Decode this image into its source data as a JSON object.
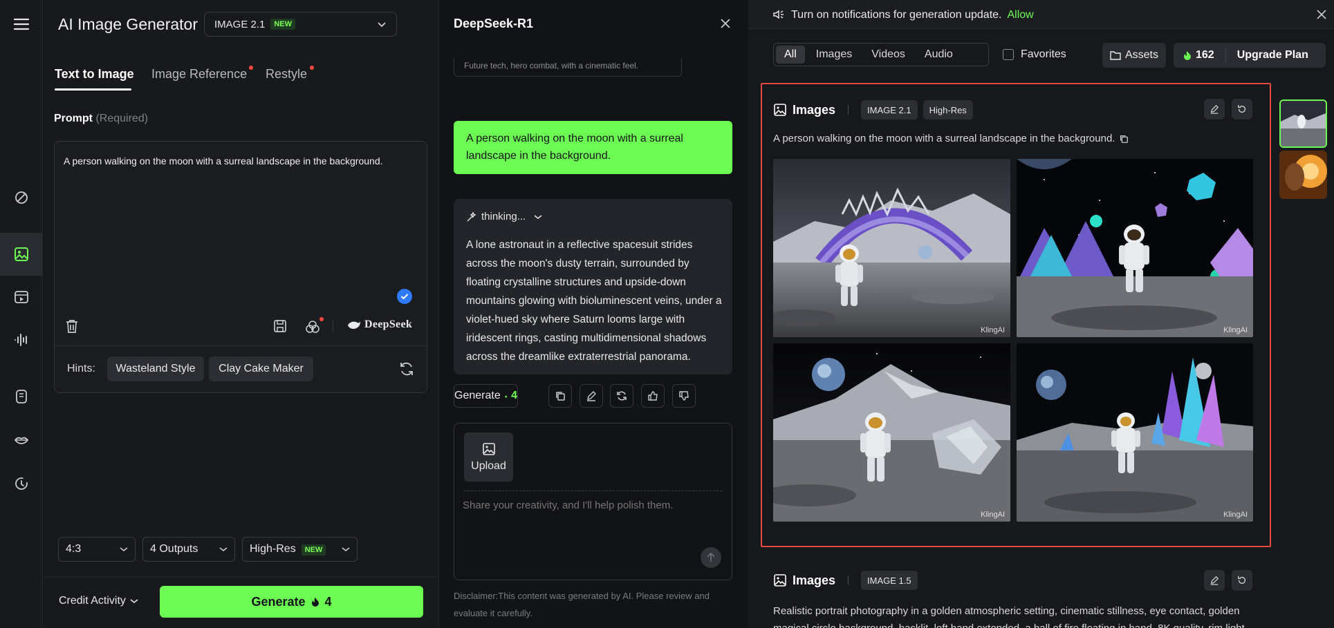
{
  "rail": {
    "items": [
      "menu-icon",
      "magic-wand-icon",
      "image-icon",
      "video-icon",
      "audio-wave-icon",
      "avatar-icon",
      "lips-icon",
      "history-icon"
    ]
  },
  "left_panel": {
    "app_title": "AI Image Generator",
    "model": {
      "name": "IMAGE 2.1",
      "badge": "NEW"
    },
    "tabs": [
      {
        "label": "Text to Image",
        "active": true
      },
      {
        "label": "Image Reference",
        "dot": true
      },
      {
        "label": "Restyle",
        "dot": true
      }
    ],
    "prompt_label": "Prompt",
    "prompt_required": "(Required)",
    "prompt_text": "A person walking on the moon with a surreal landscape in the background.",
    "deepseek_label": "DeepSeek",
    "hints_label": "Hints:",
    "hints": [
      "Wasteland Style",
      "Clay Cake Maker"
    ],
    "aspect_ratio": "4:3",
    "outputs": "4 Outputs",
    "quality": "High-Res",
    "quality_badge": "NEW",
    "credit_activity": "Credit Activity",
    "generate_label": "Generate",
    "generate_cost": "4"
  },
  "middle_panel": {
    "title": "DeepSeek-R1",
    "previous_suggestion": "Future tech, hero combat, with a cinematic feel.",
    "user_message": "A person walking on the moon with a surreal landscape in the background.",
    "thinking_label": "thinking...",
    "response": "A lone astronaut in a reflective spacesuit strides across the moon's dusty terrain, surrounded by floating crystalline structures and upside-down mountains glowing with bioluminescent veins, under a violet-hued sky where Saturn looms large with iridescent rings, casting multidimensional shadows across the dreamlike extraterrestrial panorama.",
    "generate_label": "Generate",
    "generate_cost": "4",
    "upload_label": "Upload",
    "input_placeholder": "Share your creativity, and I'll help polish them.",
    "disclaimer": "Disclaimer:This content was generated by AI. Please review and evaluate it carefully."
  },
  "right_panel": {
    "notification": "Turn on notifications for generation update.",
    "notification_action": "Allow",
    "filters": [
      {
        "label": "All",
        "active": true
      },
      {
        "label": "Images"
      },
      {
        "label": "Videos"
      },
      {
        "label": "Audio"
      }
    ],
    "favorites_label": "Favorites",
    "assets_label": "Assets",
    "credits": "162",
    "upgrade_label": "Upgrade Plan",
    "cards": [
      {
        "title": "Images",
        "tags": [
          "IMAGE 2.1",
          "High-Res"
        ],
        "prompt": "A person walking on the moon with a surreal landscape in the background.",
        "watermark": "KlingAI"
      },
      {
        "title": "Images",
        "tags": [
          "IMAGE 1.5"
        ],
        "prompt": "Realistic portrait photography in a golden atmospheric setting, cinematic stillness, eye contact, golden magical circle background, backlit, left hand extended, a ball of fire floating in hand, 8K quality, rim light"
      }
    ]
  },
  "colors": {
    "accent": "#6cfb53",
    "highlight_border": "#e34b3f",
    "dot": "#ff4a3d",
    "check": "#2f7bff"
  }
}
